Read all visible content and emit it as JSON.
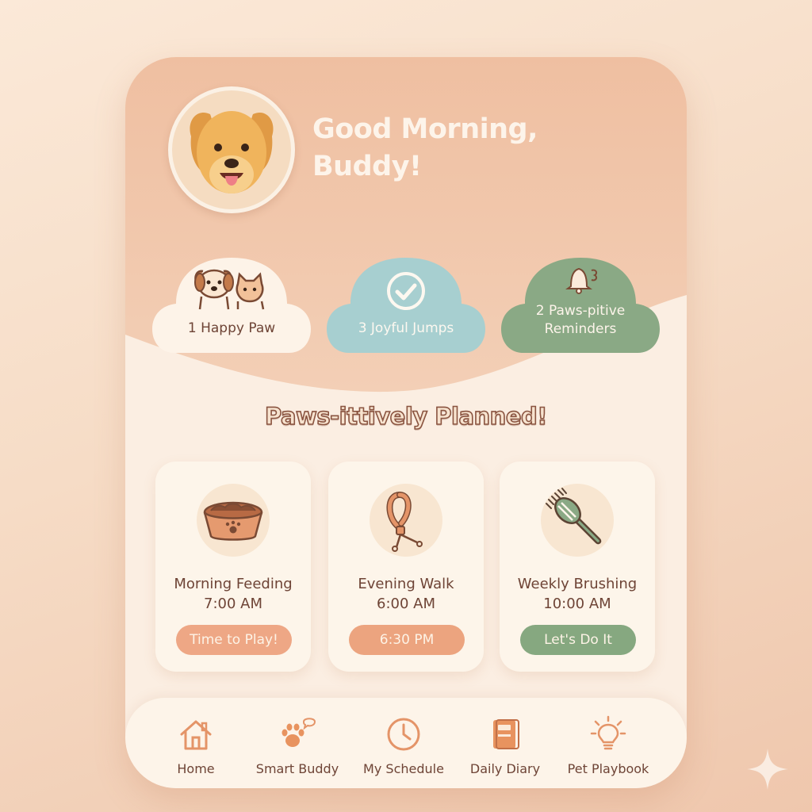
{
  "header": {
    "greeting_line1": "Good Morning,",
    "greeting_line2": "Buddy!"
  },
  "stats": [
    {
      "label": "1 Happy Paw",
      "icon": "dog-cat-icon"
    },
    {
      "label": "3 Joyful Jumps",
      "icon": "check-circle-icon"
    },
    {
      "label_line1": "2 Paws-pitive",
      "label_line2": "Reminders",
      "icon": "bell-icon"
    }
  ],
  "section": {
    "title": "Paws-ittively Planned!"
  },
  "tasks": [
    {
      "name": "Morning Feeding",
      "time": "7:00 AM",
      "button": "Time to Play!",
      "icon": "food-bowl-icon",
      "button_color": "#eea785"
    },
    {
      "name": "Evening Walk",
      "time": "6:00 AM",
      "button": "6:30 PM",
      "icon": "leash-icon",
      "button_color": "#eca47f"
    },
    {
      "name": "Weekly Brushing",
      "time": "10:00 AM",
      "button": "Let's Do It",
      "icon": "brush-icon",
      "button_color": "#86a880"
    }
  ],
  "nav": [
    {
      "label": "Home",
      "icon": "home-icon"
    },
    {
      "label": "Smart Buddy",
      "icon": "paw-chat-icon"
    },
    {
      "label": "My Schedule",
      "icon": "clock-icon"
    },
    {
      "label": "Daily Diary",
      "icon": "book-icon"
    },
    {
      "label": "Pet Playbook",
      "icon": "lightbulb-icon"
    }
  ],
  "colors": {
    "header": "#efc2a5",
    "card_bg": "#fdf5ea",
    "accent_peach": "#eea785",
    "accent_blue": "#a6cfd0",
    "accent_green": "#8aa985",
    "text_brown": "#6e4436"
  }
}
